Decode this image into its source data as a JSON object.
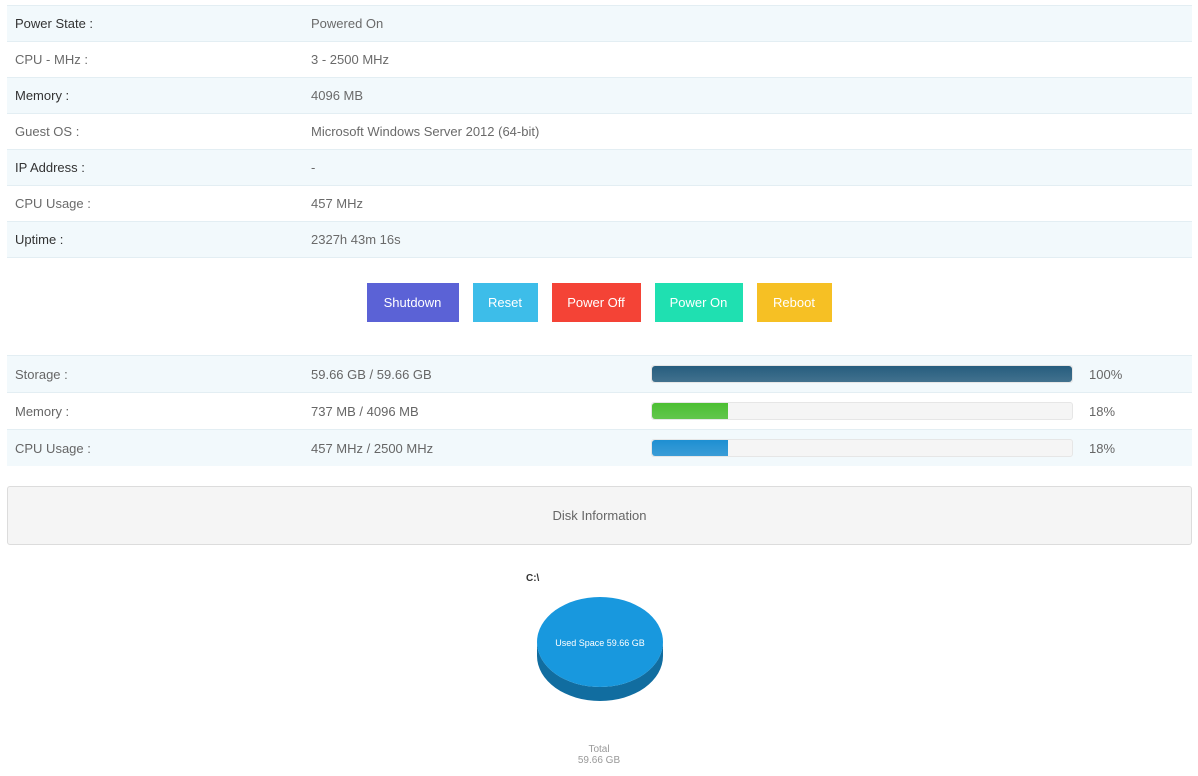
{
  "details": [
    {
      "label": "Power State :",
      "value": "Powered On"
    },
    {
      "label": "CPU - MHz :",
      "value": "3 - 2500 MHz"
    },
    {
      "label": "Memory :",
      "value": "4096 MB"
    },
    {
      "label": "Guest OS :",
      "value": "Microsoft Windows Server 2012 (64-bit)"
    },
    {
      "label": "IP Address :",
      "value": "-"
    },
    {
      "label": "CPU Usage :",
      "value": "457 MHz"
    },
    {
      "label": "Uptime :",
      "value": "2327h 43m 16s"
    }
  ],
  "actions": {
    "shutdown": {
      "label": "Shutdown",
      "color": "#5b62d6"
    },
    "reset": {
      "label": "Reset",
      "color": "#3dbde9"
    },
    "power_off": {
      "label": "Power Off",
      "color": "#f44336"
    },
    "power_on": {
      "label": "Power On",
      "color": "#1fe0b1"
    },
    "reboot": {
      "label": "Reboot",
      "color": "#f6c024"
    }
  },
  "usage": [
    {
      "label": "Storage :",
      "value": "59.66 GB / 59.66 GB",
      "percent": 100,
      "percent_label": "100%",
      "color": "#265d7e"
    },
    {
      "label": "Memory :",
      "value": "737 MB / 4096 MB",
      "percent": 18,
      "percent_label": "18%",
      "color": "#4bbf32"
    },
    {
      "label": "CPU Usage :",
      "value": "457 MHz / 2500 MHz",
      "percent": 18,
      "percent_label": "18%",
      "color": "#1e8fd2"
    }
  ],
  "disk_info": {
    "title": "Disk Information"
  },
  "chart_data": {
    "type": "pie",
    "title": "C:\\",
    "slices": [
      {
        "label": "Used Space 59.66 GB",
        "value": 59.66,
        "color": "#1898de"
      }
    ],
    "total_label": "Total",
    "total_value": "59.66 GB"
  }
}
